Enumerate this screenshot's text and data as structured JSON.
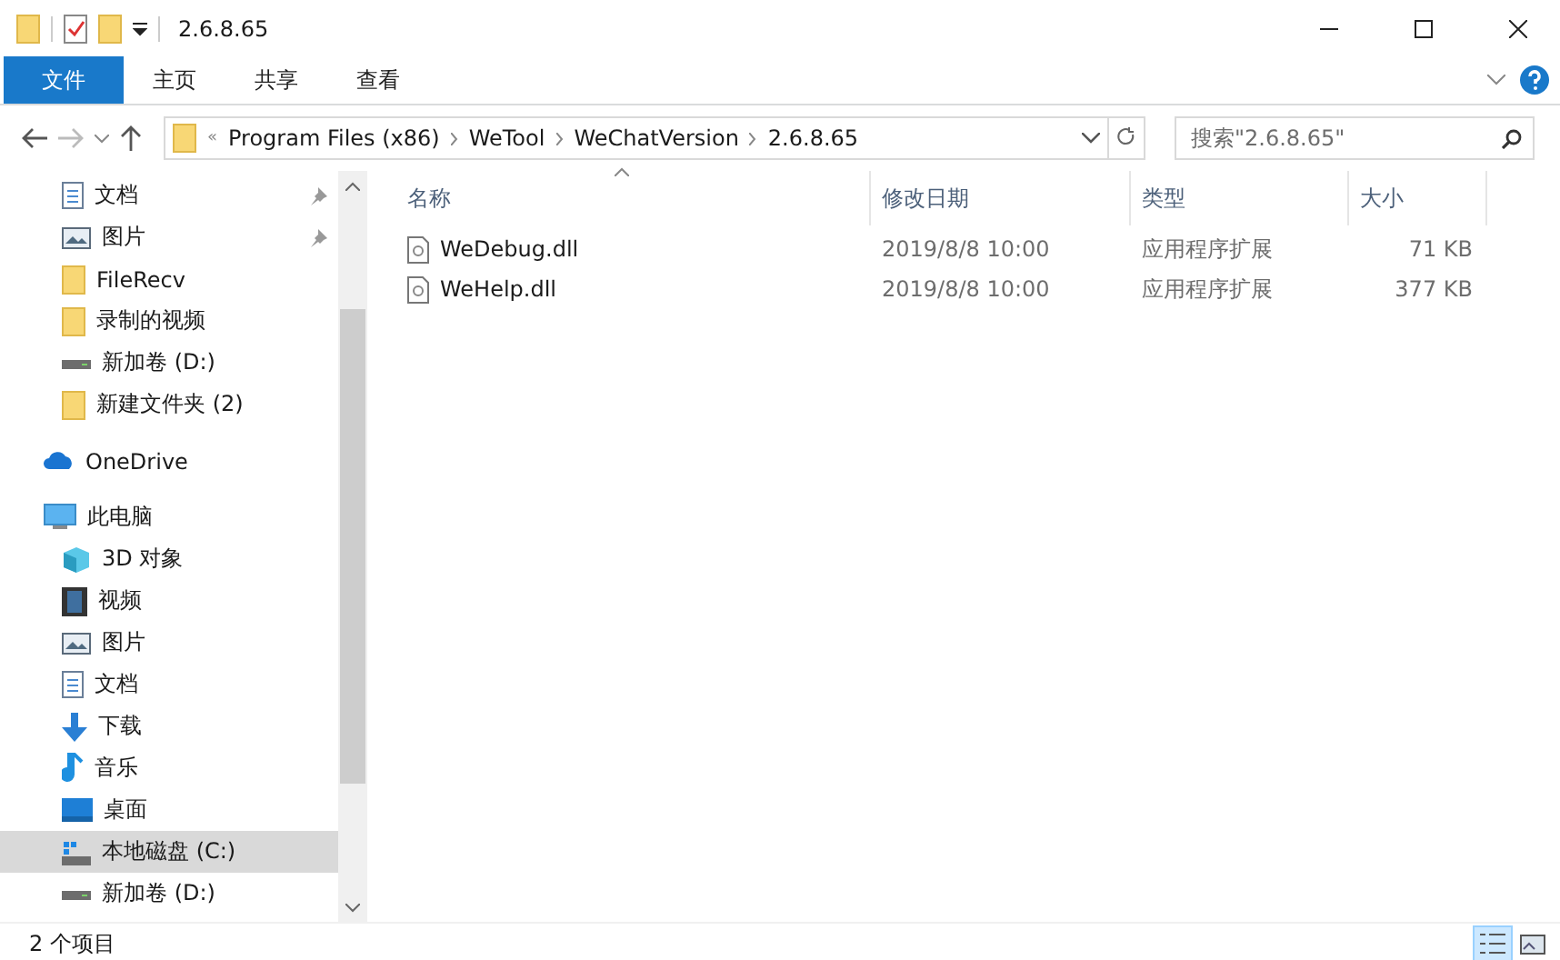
{
  "window": {
    "title": "2.6.8.65"
  },
  "ribbon_tabs": [
    {
      "label": "文件",
      "selected": true
    },
    {
      "label": "主页",
      "selected": false
    },
    {
      "label": "共享",
      "selected": false
    },
    {
      "label": "查看",
      "selected": false
    }
  ],
  "address": {
    "overflow": "«",
    "crumbs": [
      "Program Files (x86)",
      "WeTool",
      "WeChatVersion",
      "2.6.8.65"
    ]
  },
  "search": {
    "placeholder": "搜索\"2.6.8.65\""
  },
  "sidebar": {
    "items": [
      {
        "label": "文档",
        "kind": "doc",
        "pinned": true,
        "selected": false
      },
      {
        "label": "图片",
        "kind": "picture",
        "pinned": true,
        "selected": false
      },
      {
        "label": "FileRecv",
        "kind": "folder",
        "pinned": false,
        "selected": false
      },
      {
        "label": "录制的视频",
        "kind": "folder",
        "pinned": false,
        "selected": false
      },
      {
        "label": "新加卷 (D:)",
        "kind": "drive",
        "pinned": false,
        "selected": false
      },
      {
        "label": "新建文件夹 (2)",
        "kind": "folder",
        "pinned": false,
        "selected": false
      },
      {
        "label": "OneDrive",
        "kind": "cloud",
        "pinned": false,
        "selected": false
      },
      {
        "label": "此电脑",
        "kind": "pc",
        "pinned": false,
        "selected": false,
        "children": [
          {
            "label": "3D 对象",
            "kind": "cube",
            "pinned": false,
            "selected": false
          },
          {
            "label": "视频",
            "kind": "film",
            "pinned": false,
            "selected": false
          },
          {
            "label": "图片",
            "kind": "picture",
            "pinned": false,
            "selected": false
          },
          {
            "label": "文档",
            "kind": "doc",
            "pinned": false,
            "selected": false
          },
          {
            "label": "下载",
            "kind": "download",
            "pinned": false,
            "selected": false
          },
          {
            "label": "音乐",
            "kind": "music",
            "pinned": false,
            "selected": false
          },
          {
            "label": "桌面",
            "kind": "desktop",
            "pinned": false,
            "selected": false
          },
          {
            "label": "本地磁盘 (C:)",
            "kind": "localdisk",
            "pinned": false,
            "selected": true
          },
          {
            "label": "新加卷 (D:)",
            "kind": "drive",
            "pinned": false,
            "selected": false
          }
        ]
      }
    ]
  },
  "table": {
    "columns": [
      "名称",
      "修改日期",
      "类型",
      "大小"
    ],
    "rows": [
      {
        "name": "WeDebug.dll",
        "date": "2019/8/8 10:00",
        "type": "应用程序扩展",
        "size": "71 KB"
      },
      {
        "name": "WeHelp.dll",
        "date": "2019/8/8 10:00",
        "type": "应用程序扩展",
        "size": "377 KB"
      }
    ]
  },
  "status_bar": {
    "text": "2 个项目"
  },
  "view_buttons": [
    {
      "kind": "details",
      "selected": true
    },
    {
      "kind": "tiles",
      "selected": false
    }
  ]
}
